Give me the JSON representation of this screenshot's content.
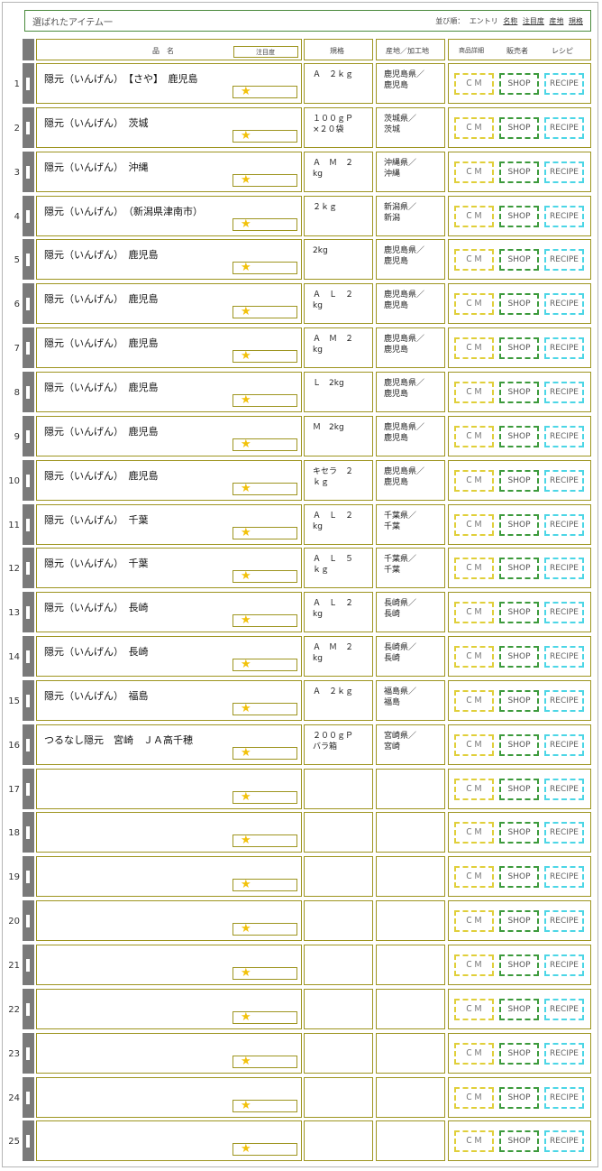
{
  "header": {
    "title": "選ばれたアイテム一",
    "sort_label": "並び順：",
    "sort_entry": "エントリ",
    "sort_links": [
      "名称",
      "注目度",
      "産地",
      "規格"
    ]
  },
  "columns": {
    "name": "品　名",
    "attention": "注目度",
    "spec": "規格",
    "origin": "産地／加工地",
    "detail": "商品詳細",
    "seller": "販売者",
    "recipe": "レシピ"
  },
  "buttons": {
    "cm": "ＣＭ",
    "shop": "SHOP",
    "recipe": "RECIPE"
  },
  "star_glyph": "★",
  "colors": {
    "border": "#9e9520",
    "star": "#f2c20c",
    "cm": "#e0cf3a",
    "shop": "#3c9a3c",
    "recipe": "#4cd6e6",
    "frame": "#4a8a3c"
  },
  "rows": [
    {
      "num": "1",
      "name": "隠元（いんげん）　【さや】　鹿児島",
      "spec": "Ａ　２ｋｇ",
      "origin": "鹿児島県／\n鹿児島"
    },
    {
      "num": "2",
      "name": "隠元（いんげん）　茨城",
      "spec": "１００ｇＰ\n×２０袋",
      "origin": "茨城県／\n茨城"
    },
    {
      "num": "3",
      "name": "隠元（いんげん）　沖縄",
      "spec": "Ａ　Ｍ　２\nkg",
      "origin": "沖縄県／\n沖縄"
    },
    {
      "num": "4",
      "name": "隠元（いんげん）　（新潟県津南市）",
      "spec": "２ｋｇ",
      "origin": "新潟県／\n新潟"
    },
    {
      "num": "5",
      "name": "隠元（いんげん）　鹿児島",
      "spec": "2kg",
      "origin": "鹿児島県／\n鹿児島"
    },
    {
      "num": "6",
      "name": "隠元（いんげん）　鹿児島",
      "spec": "Ａ　Ｌ　２\nkg",
      "origin": "鹿児島県／\n鹿児島"
    },
    {
      "num": "7",
      "name": "隠元（いんげん）　鹿児島",
      "spec": "Ａ　Ｍ　２\nkg",
      "origin": "鹿児島県／\n鹿児島"
    },
    {
      "num": "8",
      "name": "隠元（いんげん）　鹿児島",
      "spec": "Ｌ　2kg",
      "origin": "鹿児島県／\n鹿児島"
    },
    {
      "num": "9",
      "name": "隠元（いんげん）　鹿児島",
      "spec": "Ｍ　2kg",
      "origin": "鹿児島県／\n鹿児島"
    },
    {
      "num": "10",
      "name": "隠元（いんげん）　鹿児島",
      "spec": "キセラ　２\nｋｇ",
      "origin": "鹿児島県／\n鹿児島"
    },
    {
      "num": "11",
      "name": "隠元（いんげん）　千葉",
      "spec": "Ａ　Ｌ　２\nkg",
      "origin": "千葉県／\n千葉"
    },
    {
      "num": "12",
      "name": "隠元（いんげん）　千葉",
      "spec": "Ａ　Ｌ　５\nｋｇ",
      "origin": "千葉県／\n千葉"
    },
    {
      "num": "13",
      "name": "隠元（いんげん）　長崎",
      "spec": "Ａ　Ｌ　２\nkg",
      "origin": "長崎県／\n長崎"
    },
    {
      "num": "14",
      "name": "隠元（いんげん）　長崎",
      "spec": "Ａ　Ｍ　２\nkg",
      "origin": "長崎県／\n長崎"
    },
    {
      "num": "15",
      "name": "隠元（いんげん）　福島",
      "spec": "Ａ　２ｋｇ",
      "origin": "福島県／\n福島"
    },
    {
      "num": "16",
      "name": "つるなし隠元　宮崎　ＪＡ高千穂",
      "spec": "２００ｇＰ\nバラ箱",
      "origin": "宮崎県／\n宮崎"
    },
    {
      "num": "17",
      "name": "",
      "spec": "",
      "origin": ""
    },
    {
      "num": "18",
      "name": "",
      "spec": "",
      "origin": ""
    },
    {
      "num": "19",
      "name": "",
      "spec": "",
      "origin": ""
    },
    {
      "num": "20",
      "name": "",
      "spec": "",
      "origin": ""
    },
    {
      "num": "21",
      "name": "",
      "spec": "",
      "origin": ""
    },
    {
      "num": "22",
      "name": "",
      "spec": "",
      "origin": ""
    },
    {
      "num": "23",
      "name": "",
      "spec": "",
      "origin": ""
    },
    {
      "num": "24",
      "name": "",
      "spec": "",
      "origin": ""
    },
    {
      "num": "25",
      "name": "",
      "spec": "",
      "origin": ""
    }
  ]
}
